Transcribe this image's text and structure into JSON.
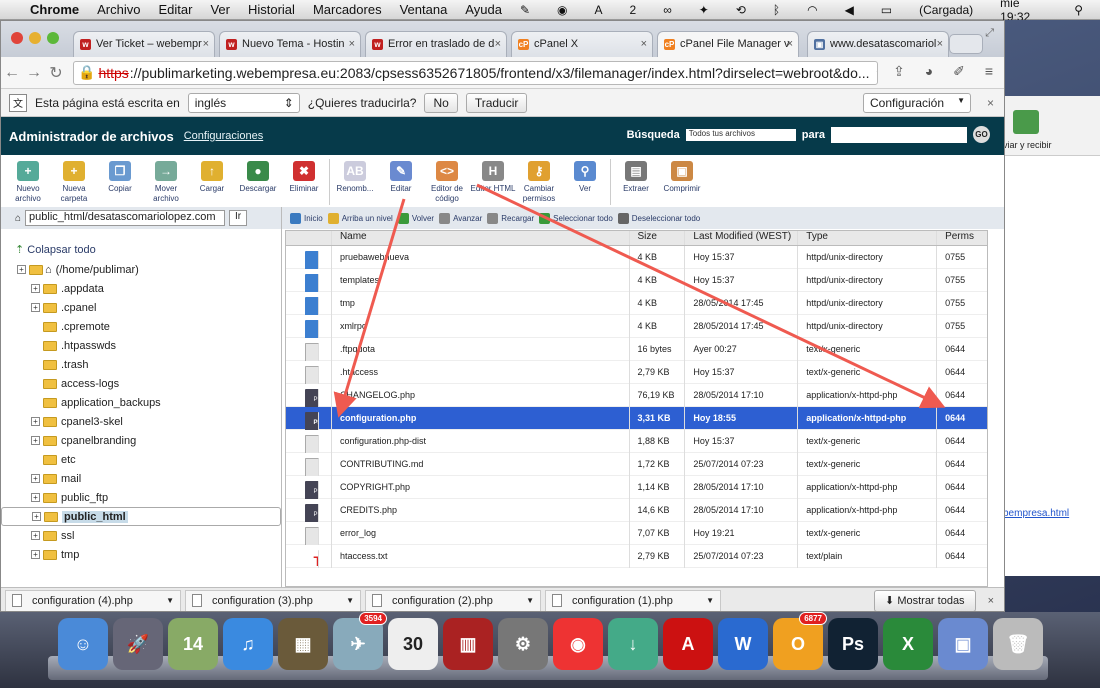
{
  "mac_menubar": {
    "app": "Chrome",
    "items": [
      "Archivo",
      "Editar",
      "Ver",
      "Historial",
      "Marcadores",
      "Ventana",
      "Ayuda"
    ],
    "status_right": [
      "2",
      "(Cargada)",
      "mié 19:32"
    ]
  },
  "browser": {
    "tabs": [
      {
        "label": "Ver Ticket – webempr",
        "fav": "w",
        "color": "#c02020"
      },
      {
        "label": "Nuevo Tema - Hostin",
        "fav": "w",
        "color": "#c02020"
      },
      {
        "label": "Error en traslado de d",
        "fav": "w",
        "color": "#c02020"
      },
      {
        "label": "cPanel X",
        "fav": "cP",
        "color": "#f08020"
      },
      {
        "label": "cPanel File Manager v",
        "fav": "cP",
        "color": "#f08020"
      },
      {
        "label": "www.desatascomariol",
        "fav": "▣",
        "color": "#5070a0"
      }
    ],
    "active_tab": 4,
    "url_scheme": "https",
    "url_rest": "://publimarketing.webempresa.eu:2083/cpsess6352671805/frontend/x3/filemanager/index.html?dirselect=webroot&do..."
  },
  "translate_bar": {
    "text": "Esta página está escrita en",
    "language": "inglés",
    "question": "¿Quieres traducirla?",
    "no_label": "No",
    "translate_label": "Traducir",
    "config_label": "Configuración"
  },
  "cpanel": {
    "title": "Administrador de archivos",
    "config_link": "Configuraciones",
    "search_label": "Búsqueda",
    "search_select": "Todos tus archivos",
    "search_para": "para",
    "go_label": "GO",
    "toolbar": [
      {
        "label": "Nuevo archivo",
        "icon": "+",
        "color": "#5a9"
      },
      {
        "label": "Nueva carpeta",
        "icon": "+",
        "color": "#e0b030"
      },
      {
        "label": "Copiar",
        "icon": "❐",
        "color": "#6a9ad0"
      },
      {
        "label": "Mover archivo",
        "icon": "→",
        "color": "#7a9"
      },
      {
        "label": "Cargar",
        "icon": "↑",
        "color": "#e0b030"
      },
      {
        "label": "Descargar",
        "icon": "●",
        "color": "#3a8a4a"
      },
      {
        "label": "Eliminar",
        "icon": "✖",
        "color": "#d03030"
      },
      {
        "label": "Renomb...",
        "icon": "AB",
        "color": "#ccd"
      },
      {
        "label": "Editar",
        "icon": "✎",
        "color": "#6a8ad0"
      },
      {
        "label": "Editor de código",
        "icon": "&lt;&gt;",
        "color": "#d84"
      },
      {
        "label": "Editor HTML",
        "icon": "H",
        "color": "#888"
      },
      {
        "label": "Cambiar permisos",
        "icon": "⚷",
        "color": "#e0a030"
      },
      {
        "label": "Ver",
        "icon": "⚲",
        "color": "#5a8ad0"
      },
      {
        "label": "Extraer",
        "icon": "▤",
        "color": "#777"
      },
      {
        "label": "Comprimir",
        "icon": "▣",
        "color": "#c84"
      }
    ],
    "path_value": "public_html/desatascomariolopez.com",
    "path_go": "Ir",
    "collapse": "Colapsar todo",
    "tree": [
      {
        "label": "(/home/publimar)",
        "level": 0,
        "plus": true,
        "root": true
      },
      {
        "label": ".appdata",
        "level": 1,
        "plus": true
      },
      {
        "label": ".cpanel",
        "level": 1,
        "plus": true
      },
      {
        "label": ".cpremote",
        "level": 1,
        "plus": false
      },
      {
        "label": ".htpasswds",
        "level": 1,
        "plus": false
      },
      {
        "label": ".trash",
        "level": 1,
        "plus": false
      },
      {
        "label": "access-logs",
        "level": 1,
        "plus": false
      },
      {
        "label": "application_backups",
        "level": 1,
        "plus": false
      },
      {
        "label": "cpanel3-skel",
        "level": 1,
        "plus": true
      },
      {
        "label": "cpanelbranding",
        "level": 1,
        "plus": true
      },
      {
        "label": "etc",
        "level": 1,
        "plus": false
      },
      {
        "label": "mail",
        "level": 1,
        "plus": true
      },
      {
        "label": "public_ftp",
        "level": 1,
        "plus": true
      },
      {
        "label": "public_html",
        "level": 1,
        "plus": true,
        "selected": true
      },
      {
        "label": "ssl",
        "level": 1,
        "plus": true
      },
      {
        "label": "tmp",
        "level": 1,
        "plus": true
      }
    ],
    "filebar": [
      "Inicio",
      "Arriba un nivel",
      "Volver",
      "Avanzar",
      "Recargar",
      "Seleccionar todo",
      "Deseleccionar todo"
    ],
    "columns": [
      "",
      "Name",
      "Size",
      "Last Modified (WEST)",
      "Type",
      "Perms"
    ],
    "files": [
      {
        "icon": "folder",
        "name": "pruebawebnueva",
        "size": "4 KB",
        "modified": "Hoy 15:37",
        "type": "httpd/unix-directory",
        "perms": "0755"
      },
      {
        "icon": "folder",
        "name": "templates",
        "size": "4 KB",
        "modified": "Hoy 15:37",
        "type": "httpd/unix-directory",
        "perms": "0755"
      },
      {
        "icon": "folder",
        "name": "tmp",
        "size": "4 KB",
        "modified": "28/05/2014 17:45",
        "type": "httpd/unix-directory",
        "perms": "0755"
      },
      {
        "icon": "folder",
        "name": "xmlrpc",
        "size": "4 KB",
        "modified": "28/05/2014 17:45",
        "type": "httpd/unix-directory",
        "perms": "0755"
      },
      {
        "icon": "text",
        "name": ".ftpquota",
        "size": "16 bytes",
        "modified": "Ayer 00:27",
        "type": "text/x-generic",
        "perms": "0644"
      },
      {
        "icon": "text",
        "name": ".htaccess",
        "size": "2,79 KB",
        "modified": "Hoy 15:37",
        "type": "text/x-generic",
        "perms": "0644"
      },
      {
        "icon": "php",
        "name": "CHANGELOG.php",
        "size": "76,19 KB",
        "modified": "28/05/2014 17:10",
        "type": "application/x-httpd-php",
        "perms": "0644"
      },
      {
        "icon": "php",
        "name": "configuration.php",
        "size": "3,31 KB",
        "modified": "Hoy 18:55",
        "type": "application/x-httpd-php",
        "perms": "0644",
        "selected": true
      },
      {
        "icon": "text",
        "name": "configuration.php-dist",
        "size": "1,88 KB",
        "modified": "Hoy 15:37",
        "type": "text/x-generic",
        "perms": "0644"
      },
      {
        "icon": "text",
        "name": "CONTRIBUTING.md",
        "size": "1,72 KB",
        "modified": "25/07/2014 07:23",
        "type": "text/x-generic",
        "perms": "0644"
      },
      {
        "icon": "php",
        "name": "COPYRIGHT.php",
        "size": "1,14 KB",
        "modified": "28/05/2014 17:10",
        "type": "application/x-httpd-php",
        "perms": "0644"
      },
      {
        "icon": "php",
        "name": "CREDITS.php",
        "size": "14,6 KB",
        "modified": "28/05/2014 17:10",
        "type": "application/x-httpd-php",
        "perms": "0644"
      },
      {
        "icon": "text",
        "name": "error_log",
        "size": "7,07 KB",
        "modified": "Hoy 19:21",
        "type": "text/x-generic",
        "perms": "0644"
      },
      {
        "icon": "t",
        "name": "htaccess.txt",
        "size": "2,79 KB",
        "modified": "25/07/2014 07:23",
        "type": "text/plain",
        "perms": "0644"
      }
    ]
  },
  "downloads": {
    "items": [
      "configuration (4).php",
      "configuration (3).php",
      "configuration (2).php",
      "configuration (1).php"
    ],
    "show_all": "Mostrar todas"
  },
  "background_window": {
    "ribbon_label": "viar y recibir",
    "link": "bempresa.html"
  },
  "dock": {
    "icons": [
      {
        "name": "finder",
        "color": "#4a8ad8",
        "glyph": "☺"
      },
      {
        "name": "launchpad",
        "color": "#667",
        "glyph": "🚀"
      },
      {
        "name": "time-machine",
        "color": "#8a6",
        "glyph": "14"
      },
      {
        "name": "itunes",
        "color": "#3a8ae0",
        "glyph": "♫"
      },
      {
        "name": "iphoto",
        "color": "#6a5a3a",
        "glyph": "▦"
      },
      {
        "name": "mail",
        "color": "#8ab",
        "glyph": "✈",
        "badge": "3594"
      },
      {
        "name": "calendar",
        "color": "#eee",
        "glyph": "30"
      },
      {
        "name": "photo-booth",
        "color": "#a22",
        "glyph": "▥"
      },
      {
        "name": "system-preferences",
        "color": "#777",
        "glyph": "⚙"
      },
      {
        "name": "chrome",
        "color": "#e33",
        "glyph": "◉"
      },
      {
        "name": "downloads",
        "color": "#4a8",
        "glyph": "↓"
      },
      {
        "name": "acrobat",
        "color": "#c11",
        "glyph": "A"
      },
      {
        "name": "word",
        "color": "#2a6ad0",
        "glyph": "W"
      },
      {
        "name": "outlook",
        "color": "#f0a020",
        "glyph": "O",
        "badge": "6877"
      },
      {
        "name": "photoshop",
        "color": "#123",
        "glyph": "Ps"
      },
      {
        "name": "excel",
        "color": "#2a8a3a",
        "glyph": "X"
      },
      {
        "name": "preview",
        "color": "#6a8ad0",
        "glyph": "▣"
      },
      {
        "name": "trash",
        "color": "#bbb",
        "glyph": "🗑"
      }
    ]
  }
}
